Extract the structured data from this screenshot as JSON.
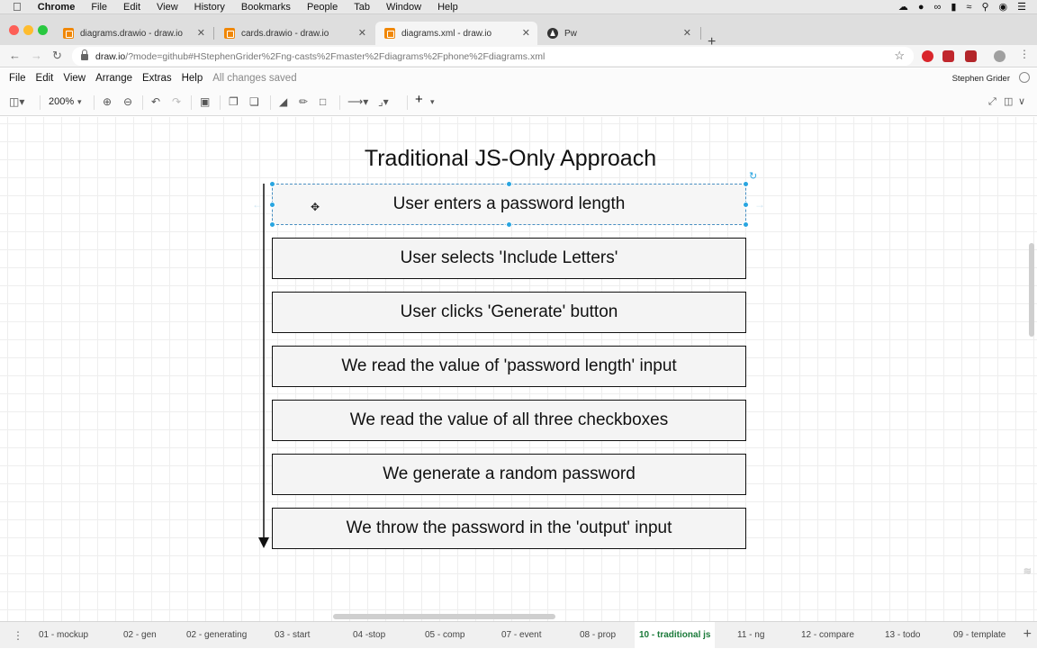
{
  "mac_menu": {
    "app": "Chrome",
    "items": [
      "File",
      "Edit",
      "View",
      "History",
      "Bookmarks",
      "People",
      "Tab",
      "Window",
      "Help"
    ]
  },
  "browser": {
    "tabs": [
      {
        "title": "diagrams.drawio - draw.io",
        "icon": "drawio-icon"
      },
      {
        "title": "cards.drawio - draw.io",
        "icon": "drawio-icon"
      },
      {
        "title": "diagrams.xml - draw.io",
        "icon": "drawio-icon"
      },
      {
        "title": "Pw",
        "icon": "angular-icon"
      }
    ],
    "active_tab": 2,
    "url_host": "draw.io",
    "url_rest": "/?mode=github#HStephenGrider%2Fng-casts%2Fmaster%2Fdiagrams%2Fphone%2Fdiagrams.xml"
  },
  "app_menu": {
    "items": [
      "File",
      "Edit",
      "View",
      "Arrange",
      "Extras",
      "Help"
    ],
    "status": "All changes saved",
    "user": "Stephen Grider"
  },
  "toolbar": {
    "zoom": "200%"
  },
  "diagram": {
    "title": "Traditional JS-Only Approach",
    "steps": [
      "User enters a password length",
      "User selects 'Include Letters'",
      "User clicks 'Generate' button",
      "We read the value of 'password length' input",
      "We read the value of all three checkboxes",
      "We generate a random password",
      "We throw the password in the 'output' input"
    ],
    "selected_step": 0
  },
  "pages": [
    "01 - mockup",
    "02 - gen",
    "02 - generating",
    "03 - start",
    "04 -stop",
    "05 - comp",
    "07 - event",
    "08 - prop",
    "10 - traditional js",
    "11 - ng",
    "12 - compare",
    "13 - todo",
    "09 - template"
  ],
  "active_page": "10 - traditional js",
  "colors": {
    "active_page": "#1b7a3a",
    "selection": "#29a5e0",
    "drawio_orange": "#f08705"
  }
}
